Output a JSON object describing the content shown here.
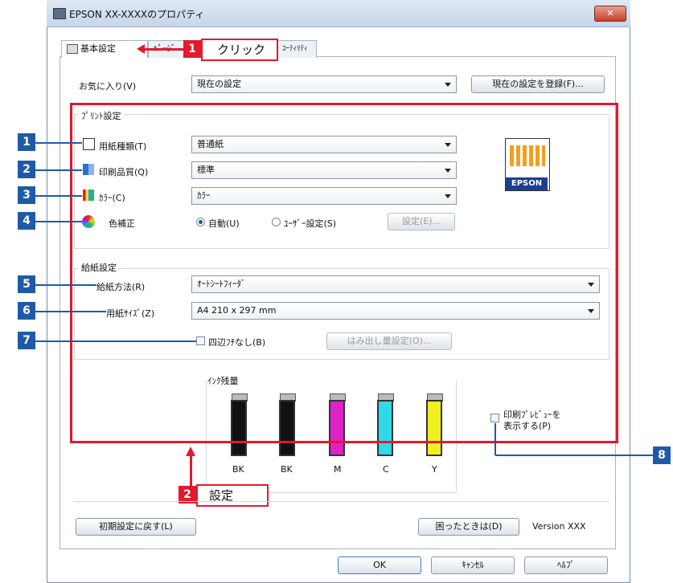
{
  "window": {
    "title": "EPSON XX-XXXXのプロパティ",
    "close": "✕"
  },
  "tabs": [
    {
      "label": "基本設定"
    },
    {
      "label": "ﾍﾟｰｼﾞ"
    },
    {
      "label": "ﾕｰﾃｨﾘﾃｨ"
    }
  ],
  "callouts": {
    "click_num": "1",
    "click_label": "クリック",
    "settings_num": "2",
    "settings_label": "設定"
  },
  "favorites": {
    "label": "お気に入り(V)",
    "value": "現在の設定",
    "register": "現在の設定を登録(F)..."
  },
  "print_settings": {
    "title": "ﾌﾟﾘﾝﾄ設定",
    "paper_type": {
      "label": "用紙種類(T)",
      "value": "普通紙"
    },
    "quality": {
      "label": "印刷品質(Q)",
      "value": "標準"
    },
    "color": {
      "label": "ｶﾗｰ(C)",
      "value": "ｶﾗｰ"
    },
    "color_correction": {
      "label": "色補正",
      "auto": "自動(U)",
      "user": "ﾕｰｻﾞｰ設定(S)",
      "settings": "設定(E)..."
    }
  },
  "feed_settings": {
    "title": "給紙設定",
    "source": {
      "label": "給紙方法(R)",
      "value": "ｵｰﾄｼｰﾄﾌｨｰﾀﾞ"
    },
    "size": {
      "label": "用紙ｻｲｽﾞ(Z)",
      "value": "A4 210 x 297 mm"
    },
    "borderless": {
      "label": "四辺ﾌﾁなし(B)"
    },
    "overflow": "はみ出し量設定(O)..."
  },
  "ink": {
    "title": "ｲﾝｸ残量",
    "cartridges": [
      {
        "name": "BK",
        "color": "#111111"
      },
      {
        "name": "BK",
        "color": "#111111"
      },
      {
        "name": "M",
        "color": "#e020c8"
      },
      {
        "name": "C",
        "color": "#30d8e8"
      },
      {
        "name": "Y",
        "color": "#f0f020"
      }
    ]
  },
  "preview": {
    "label_line1": "印刷ﾌﾟﾚﾋﾞｭｰを",
    "label_line2": "表示する(P)"
  },
  "footer": {
    "reset": "初期設定に戻す(L)",
    "help_trouble": "困ったときは(D)",
    "version": "Version XXX"
  },
  "buttons": {
    "ok": "OK",
    "cancel": "ｷｬﾝｾﾙ",
    "help": "ﾍﾙﾌﾟ"
  },
  "markers": [
    "1",
    "2",
    "3",
    "4",
    "5",
    "6",
    "7",
    "8"
  ],
  "epson_logo": "EPSON"
}
